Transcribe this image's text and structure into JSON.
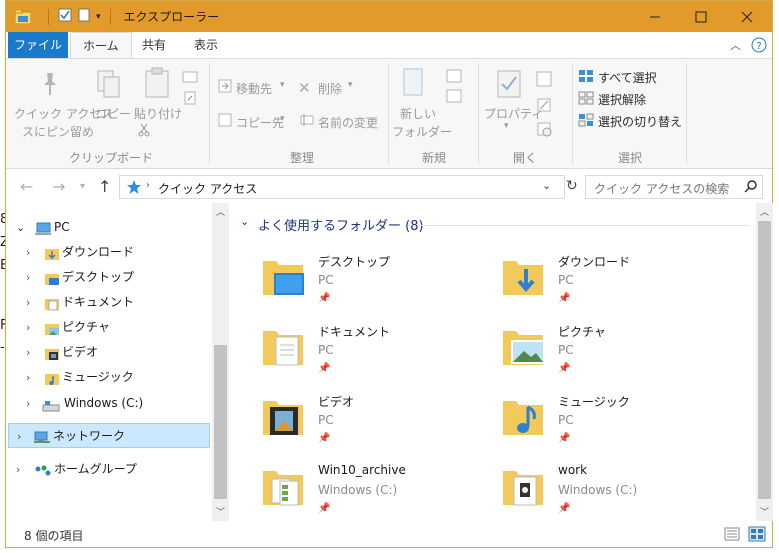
{
  "window": {
    "title": "エクスプローラー",
    "accent": "#e29a2b"
  },
  "background_text": [
    "8",
    "Z",
    "E",
    "F",
    "-"
  ],
  "ribbon_tabs": [
    {
      "label": "ファイル"
    },
    {
      "label": "ホーム"
    },
    {
      "label": "共有"
    },
    {
      "label": "表示"
    }
  ],
  "ribbon": {
    "clipboard": {
      "pin_quick_access": "クイック アクセス",
      "pin_quick_access_2": "スにピン留め",
      "copy": "コピー",
      "paste": "貼り付け",
      "group": "クリップボード"
    },
    "organize": {
      "move_to": "移動先",
      "copy_to": "コピー先",
      "delete": "削除",
      "rename": "名前の変更",
      "group": "整理"
    },
    "new": {
      "new_folder": "新しい",
      "new_folder_2": "フォルダー",
      "group": "新規"
    },
    "open": {
      "properties": "プロパティ",
      "group": "開く"
    },
    "select": {
      "select_all": "すべて選択",
      "select_none": "選択解除",
      "invert": "選択の切り替え",
      "group": "選択"
    }
  },
  "address": {
    "path": "クイック アクセス",
    "search_placeholder": "クイック アクセスの検索"
  },
  "nav_tree": [
    {
      "label": "PC",
      "icon": "pc-icon"
    },
    {
      "label": "ダウンロード",
      "icon": "download-folder-icon"
    },
    {
      "label": "デスクトップ",
      "icon": "desktop-folder-icon"
    },
    {
      "label": "ドキュメント",
      "icon": "documents-folder-icon"
    },
    {
      "label": "ピクチャ",
      "icon": "pictures-folder-icon"
    },
    {
      "label": "ビデオ",
      "icon": "videos-folder-icon"
    },
    {
      "label": "ミュージック",
      "icon": "music-folder-icon"
    },
    {
      "label": "Windows (C:)",
      "icon": "drive-icon"
    },
    {
      "label": "ネットワーク",
      "icon": "network-icon"
    },
    {
      "label": "ホームグループ",
      "icon": "homegroup-icon"
    }
  ],
  "content": {
    "section_header": "よく使用するフォルダー (8)",
    "folders": [
      {
        "name": "デスクトップ",
        "location": "PC",
        "icon": "desktop-folder-icon"
      },
      {
        "name": "ダウンロード",
        "location": "PC",
        "icon": "download-folder-icon"
      },
      {
        "name": "ドキュメント",
        "location": "PC",
        "icon": "documents-folder-icon"
      },
      {
        "name": "ピクチャ",
        "location": "PC",
        "icon": "pictures-folder-icon"
      },
      {
        "name": "ビデオ",
        "location": "PC",
        "icon": "videos-folder-icon"
      },
      {
        "name": "ミュージック",
        "location": "PC",
        "icon": "music-folder-icon"
      },
      {
        "name": "Win10_archive",
        "location": "Windows (C:)",
        "icon": "archive-folder-icon"
      },
      {
        "name": "work",
        "location": "Windows (C:)",
        "icon": "work-folder-icon"
      }
    ]
  },
  "status": {
    "item_count": "8 個の項目"
  }
}
